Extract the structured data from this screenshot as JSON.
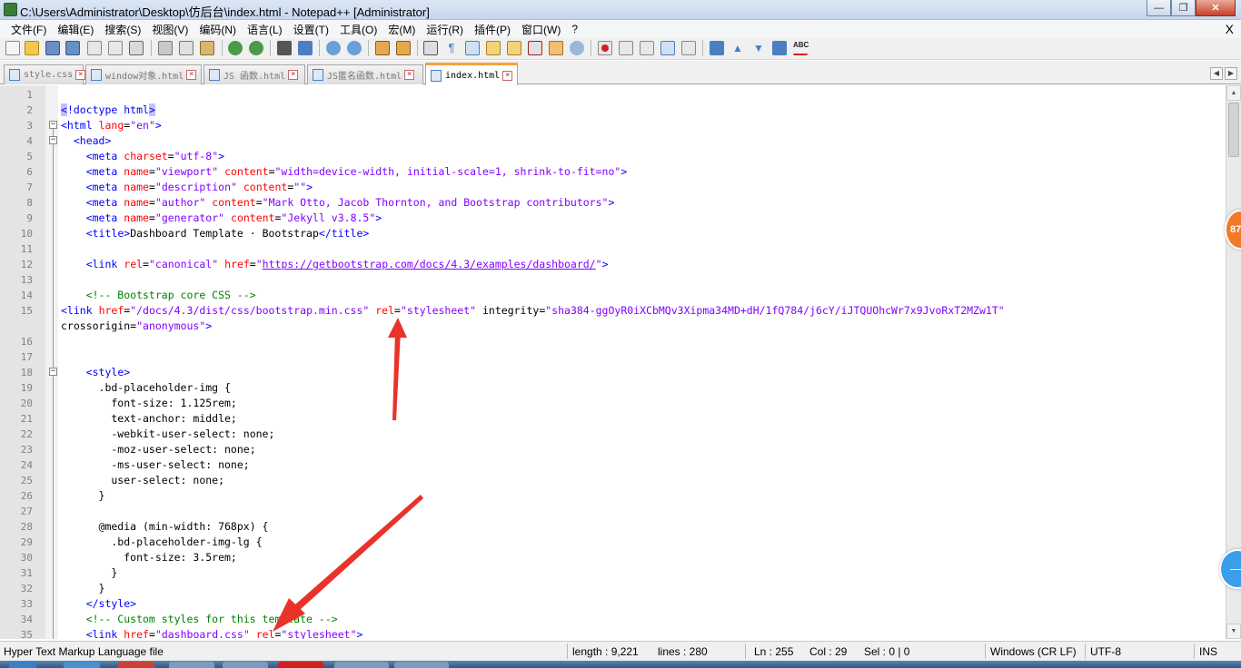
{
  "window": {
    "title": "C:\\Users\\Administrator\\Desktop\\仿后台\\index.html - Notepad++ [Administrator]",
    "minimize": "—",
    "maximize": "❐",
    "close": "✕"
  },
  "menu": {
    "items": [
      "文件(F)",
      "编辑(E)",
      "搜索(S)",
      "视图(V)",
      "编码(N)",
      "语言(L)",
      "设置(T)",
      "工具(O)",
      "宏(M)",
      "运行(R)",
      "插件(P)",
      "窗口(W)",
      "?"
    ],
    "close_label": "X"
  },
  "tabs": [
    {
      "label": "style.css",
      "active": false
    },
    {
      "label": "window对象.html",
      "active": false
    },
    {
      "label": "JS 函数.html",
      "active": false
    },
    {
      "label": "JS匿名函数.html",
      "active": false
    },
    {
      "label": "index.html",
      "active": true
    }
  ],
  "editor": {
    "lines": [
      {
        "n": "1",
        "code": ""
      },
      {
        "n": "2",
        "code": "<!doctype html>"
      },
      {
        "n": "3",
        "code": "<html lang=\"en\">"
      },
      {
        "n": "4",
        "code": "  <head>"
      },
      {
        "n": "5",
        "code": "    <meta charset=\"utf-8\">"
      },
      {
        "n": "6",
        "code": "    <meta name=\"viewport\" content=\"width=device-width, initial-scale=1, shrink-to-fit=no\">"
      },
      {
        "n": "7",
        "code": "    <meta name=\"description\" content=\"\">"
      },
      {
        "n": "8",
        "code": "    <meta name=\"author\" content=\"Mark Otto, Jacob Thornton, and Bootstrap contributors\">"
      },
      {
        "n": "9",
        "code": "    <meta name=\"generator\" content=\"Jekyll v3.8.5\">"
      },
      {
        "n": "10",
        "code": "    <title>Dashboard Template · Bootstrap</title>"
      },
      {
        "n": "11",
        "code": ""
      },
      {
        "n": "12",
        "code": "    <link rel=\"canonical\" href=\"https://getbootstrap.com/docs/4.3/examples/dashboard/\">"
      },
      {
        "n": "13",
        "code": ""
      },
      {
        "n": "14",
        "code": "    <!-- Bootstrap core CSS -->"
      },
      {
        "n": "15",
        "code": "<link href=\"/docs/4.3/dist/css/bootstrap.min.css\" rel=\"stylesheet\" integrity=\"sha384-ggOyR0iXCbMQv3Xipma34MD+dH/1fQ784/j6cY/iJTQUOhcWr7x9JvoRxT2MZw1T\""
      },
      {
        "n": "",
        "code": "crossorigin=\"anonymous\">"
      },
      {
        "n": "16",
        "code": ""
      },
      {
        "n": "17",
        "code": ""
      },
      {
        "n": "18",
        "code": "    <style>"
      },
      {
        "n": "19",
        "code": "      .bd-placeholder-img {"
      },
      {
        "n": "20",
        "code": "        font-size: 1.125rem;"
      },
      {
        "n": "21",
        "code": "        text-anchor: middle;"
      },
      {
        "n": "22",
        "code": "        -webkit-user-select: none;"
      },
      {
        "n": "23",
        "code": "        -moz-user-select: none;"
      },
      {
        "n": "24",
        "code": "        -ms-user-select: none;"
      },
      {
        "n": "25",
        "code": "        user-select: none;"
      },
      {
        "n": "26",
        "code": "      }"
      },
      {
        "n": "27",
        "code": ""
      },
      {
        "n": "28",
        "code": "      @media (min-width: 768px) {"
      },
      {
        "n": "29",
        "code": "        .bd-placeholder-img-lg {"
      },
      {
        "n": "30",
        "code": "          font-size: 3.5rem;"
      },
      {
        "n": "31",
        "code": "        }"
      },
      {
        "n": "32",
        "code": "      }"
      },
      {
        "n": "33",
        "code": "    </style>"
      },
      {
        "n": "34",
        "code": "    <!-- Custom styles for this template -->"
      },
      {
        "n": "35",
        "code": "    <link href=\"dashboard.css\" rel=\"stylesheet\">"
      }
    ]
  },
  "side_badges": {
    "orange": "87",
    "blue": "—"
  },
  "status": {
    "file_type": "Hyper Text Markup Language file",
    "length": "length : 9,221",
    "lines": "lines : 280",
    "ln": "Ln : 255",
    "col": "Col : 29",
    "sel": "Sel : 0 | 0",
    "eol": "Windows (CR LF)",
    "encoding": "UTF-8",
    "mode": "INS"
  },
  "colors": {
    "tag": "#0000ff",
    "attribute": "#ff0000",
    "value": "#8000ff",
    "comment": "#008000",
    "annotation_arrow": "#e8322a",
    "active_tab_accent": "#f7a03e"
  }
}
